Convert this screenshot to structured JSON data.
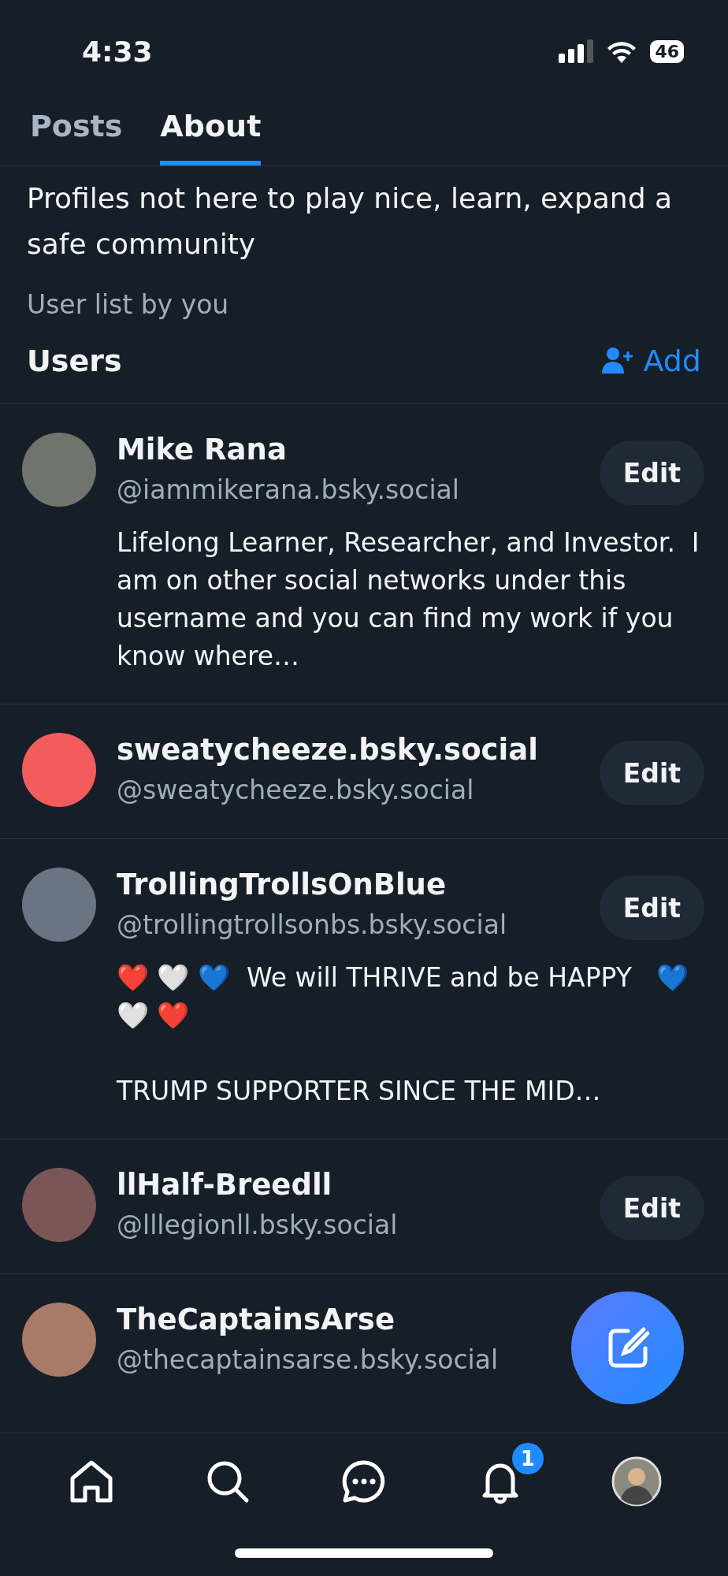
{
  "status_bar": {
    "time": "4:33",
    "battery": "46"
  },
  "tabs": [
    {
      "label": "Posts",
      "selected": false
    },
    {
      "label": "About",
      "selected": true
    }
  ],
  "description": "Profiles not here to play nice, learn, expand a safe community",
  "byline": "User list by you",
  "section": {
    "title": "Users",
    "action": "Add"
  },
  "users": [
    {
      "name": "Mike Rana",
      "handle": "@iammikerana.bsky.social",
      "bio": "Lifelong Learner, Researcher, and Investor.  I am on other social networks under this username and you can find my work if you know where…",
      "color": "#70746c",
      "button": "Edit"
    },
    {
      "name": "sweatycheeze.bsky.social",
      "handle": "@sweatycheeze.bsky.social",
      "color": "#f25c5c",
      "button": "Edit"
    },
    {
      "name": "TrollingTrollsOnBlue",
      "handle": "@trollingtrollsonbs.bsky.social",
      "bio": "❤️ 🤍 💙  We will THRIVE and be HAPPY   💙 🤍 ❤️\n\nTRUMP SUPPORTER SINCE THE MID…",
      "color": "#6b7482",
      "button": "Edit"
    },
    {
      "name": "llHalf-Breedll",
      "handle": "@lllegionll.bsky.social",
      "color": "#7a5656",
      "button": "Edit"
    },
    {
      "name": "TheCaptainsArse",
      "handle": "@thecaptainsarse.bsky.social",
      "color": "#a87a68"
    }
  ],
  "notifications_badge": "1"
}
